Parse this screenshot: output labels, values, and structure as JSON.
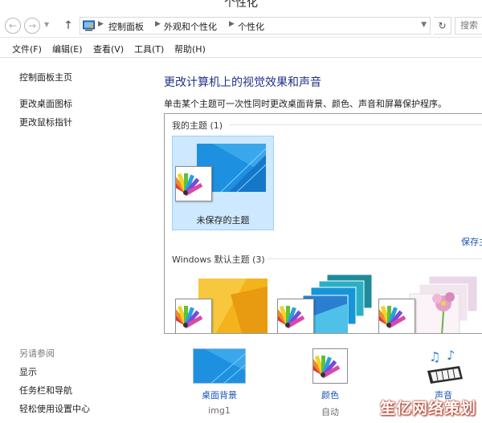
{
  "window": {
    "title": "个性化"
  },
  "address": {
    "crumbs": [
      "控制面板",
      "外观和个性化",
      "个性化"
    ],
    "search_text": "搜索"
  },
  "menu": {
    "items": [
      "文件(F)",
      "编辑(E)",
      "查看(V)",
      "工具(T)",
      "帮助(H)"
    ]
  },
  "sidebar": {
    "links": [
      "控制面板主页",
      "更改桌面图标",
      "更改鼠标指针"
    ],
    "see_also_heading": "另请参阅",
    "see_also": [
      "显示",
      "任务栏和导航",
      "轻松使用设置中心"
    ]
  },
  "main": {
    "title": "更改计算机上的视觉效果和声音",
    "description": "单击某个主题可一次性同时更改桌面背景、颜色、声音和屏幕保护程序。",
    "my_themes_label": "我的主题 (1)",
    "unsaved_theme_label": "未保存的主题",
    "save_theme_link": "保存主题",
    "windows_themes_label": "Windows 默认主题 (3)"
  },
  "bottom": {
    "background": {
      "label": "桌面背景",
      "value": "img1"
    },
    "color": {
      "label": "颜色",
      "value": "自动"
    },
    "sound": {
      "label": "声音",
      "value": ""
    }
  },
  "watermark": "笙亿网络策划",
  "colors": {
    "link": "#1b55b5",
    "title": "#1e3287",
    "selection": "#cde8ff",
    "selection_border": "#99d1ff"
  }
}
